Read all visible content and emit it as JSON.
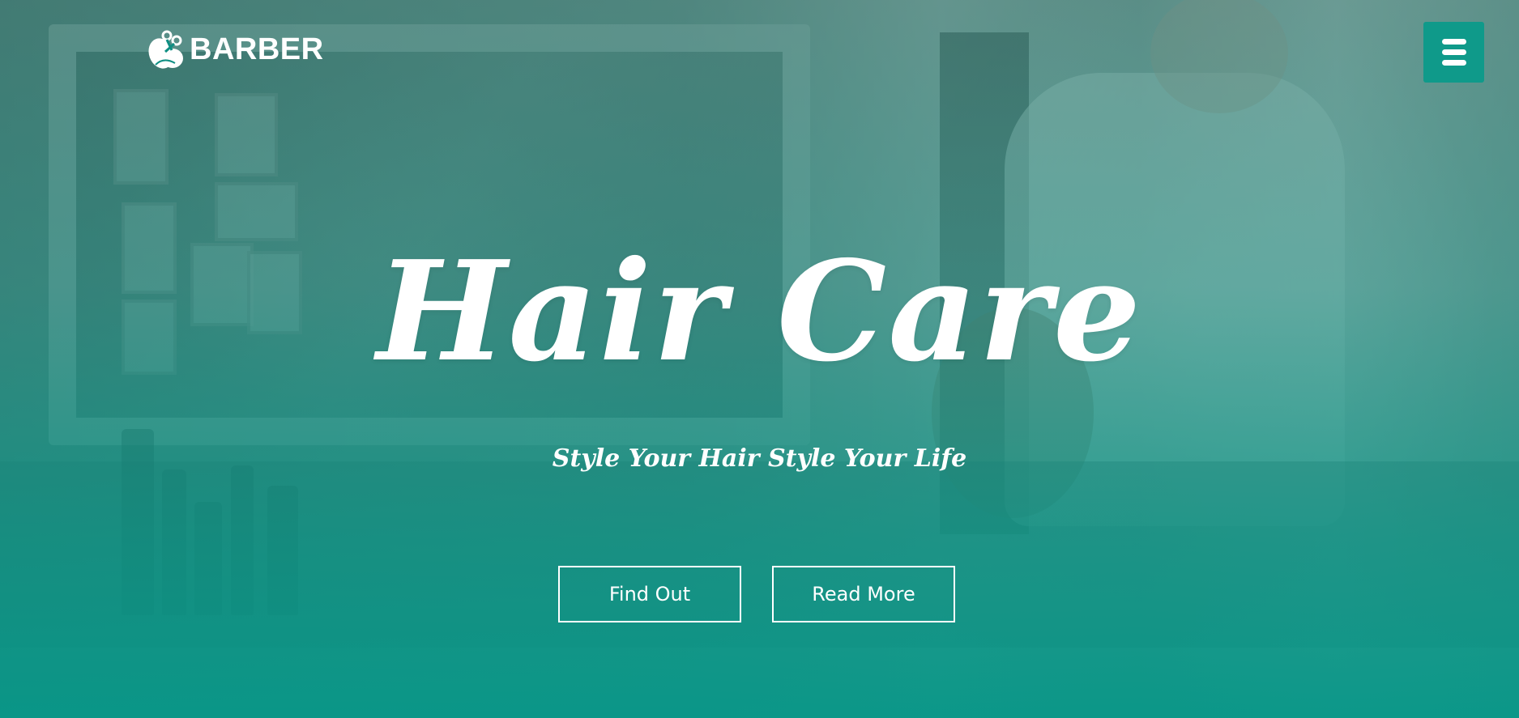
{
  "header": {
    "logo_text": "BARBER",
    "logo_icon": "barber-scissors-logo-icon",
    "menu_icon": "hamburger-menu-icon"
  },
  "hero": {
    "title": "Hair Care",
    "subtitle": "Style Your Hair Style Your Life",
    "buttons": [
      {
        "label": "Find Out"
      },
      {
        "label": "Read More"
      }
    ]
  },
  "colors": {
    "accent": "#0f9a8a",
    "overlay_bottom": "#06968a",
    "text": "#ffffff"
  }
}
